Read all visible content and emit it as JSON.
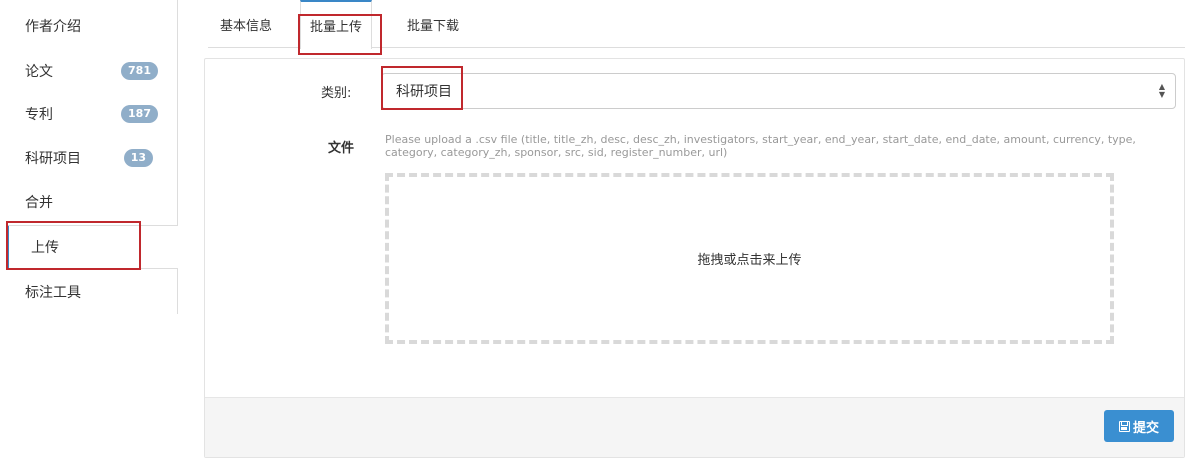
{
  "sidebar": {
    "items": [
      {
        "label": "作者介绍"
      },
      {
        "label": "论文",
        "badge": "781"
      },
      {
        "label": "专利",
        "badge": "187"
      },
      {
        "label": "科研项目",
        "badge": "13"
      },
      {
        "label": "合并"
      },
      {
        "label": "上传"
      },
      {
        "label": "标注工具"
      }
    ],
    "active": "上传"
  },
  "tabs": [
    {
      "label": "基本信息"
    },
    {
      "label": "批量上传"
    },
    {
      "label": "批量下载"
    }
  ],
  "active_tab": "批量上传",
  "form": {
    "category_label": "类别:",
    "category_value": "科研项目",
    "file_label": "文件",
    "help_text": "Please upload a .csv file (title, title_zh, desc, desc_zh, investigators, start_year, end_year, start_date, end_date, amount, currency, type, category, category_zh, sponsor, src, sid, register_number, url)",
    "dropzone_text": "拖拽或点击来上传",
    "submit_label": "提交"
  },
  "colors": {
    "accent": "#3a87c7",
    "badge": "#90aec9",
    "highlight_box": "#c0282d",
    "submit_button": "#3a8fd1"
  }
}
